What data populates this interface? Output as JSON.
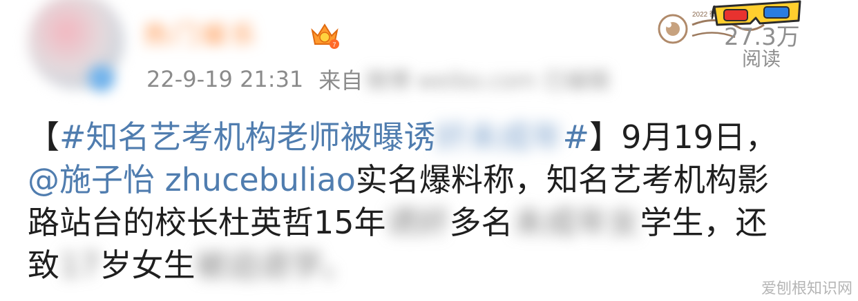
{
  "header": {
    "username_blurred": "热门娱乐",
    "timestamp": "22-9-19 21:31",
    "source_prefix": "来自",
    "source_blurred": "微博 weibo.com 已编辑",
    "read_count": "27.3万",
    "read_label": "阅读",
    "event_badge": "2022 微博 电影之夜"
  },
  "post": {
    "bracket_open": "【",
    "hashtag_visible": "#知名艺考机构老师被曝诱",
    "hashtag_blurred": "奸未成年",
    "hashtag_end": "#",
    "bracket_close": "】",
    "date_text": "9月19日，",
    "mention": "@施子怡 zhucebuliao",
    "line2_rest": " 实名爆料称，知名艺考机构影",
    "line3_a": "路站台的校长杜英哲15年",
    "line3_blur1": "诱奸",
    "line3_b": "多名",
    "line3_blur2": "未成年女",
    "line3_c": "学生，还",
    "line4_a": "致",
    "line4_blur1": "17",
    "line4_b": "岁女生",
    "line4_blur2": "被迫退学。"
  },
  "watermark": "爱刨根知识网",
  "colors": {
    "link": "#507daf",
    "username": "#ff8a3a",
    "meta": "#8b8b8b"
  }
}
